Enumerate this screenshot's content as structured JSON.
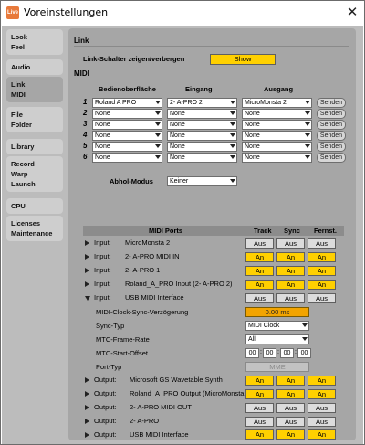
{
  "window": {
    "title": "Voreinstellungen",
    "app_icon_text": "Live",
    "close_glyph": "✕"
  },
  "sidebar": [
    {
      "lines": [
        "Look",
        "Feel"
      ],
      "active": false
    },
    {
      "lines": [
        "Audio"
      ],
      "active": false
    },
    {
      "lines": [
        "Link",
        "MIDI"
      ],
      "active": true
    },
    {
      "lines": [
        "File",
        "Folder"
      ],
      "active": false
    },
    {
      "lines": [
        "Library"
      ],
      "active": false
    },
    {
      "lines": [
        "Record",
        "Warp",
        "Launch"
      ],
      "active": false
    },
    {
      "lines": [
        "CPU"
      ],
      "active": false
    },
    {
      "lines": [
        "Licenses",
        "Maintenance"
      ],
      "active": false
    }
  ],
  "link": {
    "heading": "Link",
    "toggle_label": "Link-Schalter zeigen/verbergen",
    "toggle_value": "Show"
  },
  "midi": {
    "heading": "MIDI",
    "col_surface": "Bedienoberfläche",
    "col_input": "Eingang",
    "col_output": "Ausgang",
    "send_label": "Senden",
    "rows": [
      {
        "num": "1",
        "surface": "Roland A PRO",
        "input": "2- A-PRO 2",
        "output": "MicroMonsta 2"
      },
      {
        "num": "2",
        "surface": "None",
        "input": "None",
        "output": "None"
      },
      {
        "num": "3",
        "surface": "None",
        "input": "None",
        "output": "None"
      },
      {
        "num": "4",
        "surface": "None",
        "input": "None",
        "output": "None"
      },
      {
        "num": "5",
        "surface": "None",
        "input": "None",
        "output": "None"
      },
      {
        "num": "6",
        "surface": "None",
        "input": "None",
        "output": "None"
      }
    ],
    "takeover_label": "Abhol-Modus",
    "takeover_value": "Keiner"
  },
  "ports": {
    "header": {
      "ports": "MIDI Ports",
      "track": "Track",
      "sync": "Sync",
      "remote": "Fernst."
    },
    "rows": [
      {
        "dir": "Input:",
        "name": "MicroMonsta 2",
        "track": "Aus",
        "sync": "Aus",
        "remote": "Aus",
        "expanded": false
      },
      {
        "dir": "Input:",
        "name": "2- A-PRO MIDI IN",
        "track": "An",
        "sync": "An",
        "remote": "An",
        "expanded": false
      },
      {
        "dir": "Input:",
        "name": "2- A-PRO 1",
        "track": "An",
        "sync": "An",
        "remote": "An",
        "expanded": false
      },
      {
        "dir": "Input:",
        "name": "Roland_A_PRO Input (2- A-PRO 2)",
        "track": "An",
        "sync": "An",
        "remote": "An",
        "expanded": false
      },
      {
        "dir": "Input:",
        "name": "USB MIDI Interface",
        "track": "Aus",
        "sync": "Aus",
        "remote": "Aus",
        "expanded": true
      }
    ],
    "details": {
      "delay_label": "MIDI-Clock-Sync-Verzögerung",
      "delay_value": "0.00 ms",
      "sync_type_label": "Sync-Typ",
      "sync_type_value": "MIDI Clock",
      "mtc_rate_label": "MTC-Frame-Rate",
      "mtc_rate_value": "All",
      "mtc_offset_label": "MTC-Start-Offset",
      "mtc_offset_values": [
        "00",
        "00",
        "00",
        "00"
      ],
      "port_type_label": "Port-Typ",
      "port_type_value": "MME"
    },
    "outputs": [
      {
        "dir": "Output:",
        "name": "Microsoft GS Wavetable Synth",
        "track": "An",
        "sync": "An",
        "remote": "An"
      },
      {
        "dir": "Output:",
        "name": "Roland_A_PRO Output (MicroMonsta",
        "track": "An",
        "sync": "An",
        "remote": "An"
      },
      {
        "dir": "Output:",
        "name": "2- A-PRO MIDI OUT",
        "track": "Aus",
        "sync": "Aus",
        "remote": "Aus"
      },
      {
        "dir": "Output:",
        "name": "2- A-PRO",
        "track": "Aus",
        "sync": "Aus",
        "remote": "Aus"
      },
      {
        "dir": "Output:",
        "name": "USB MIDI Interface",
        "track": "An",
        "sync": "An",
        "remote": "An"
      }
    ]
  },
  "colors": {
    "accent_yellow": "#ffd000",
    "field_orange": "#f2a400",
    "panel": "#a6a6a6",
    "background": "#bcbcbc"
  }
}
